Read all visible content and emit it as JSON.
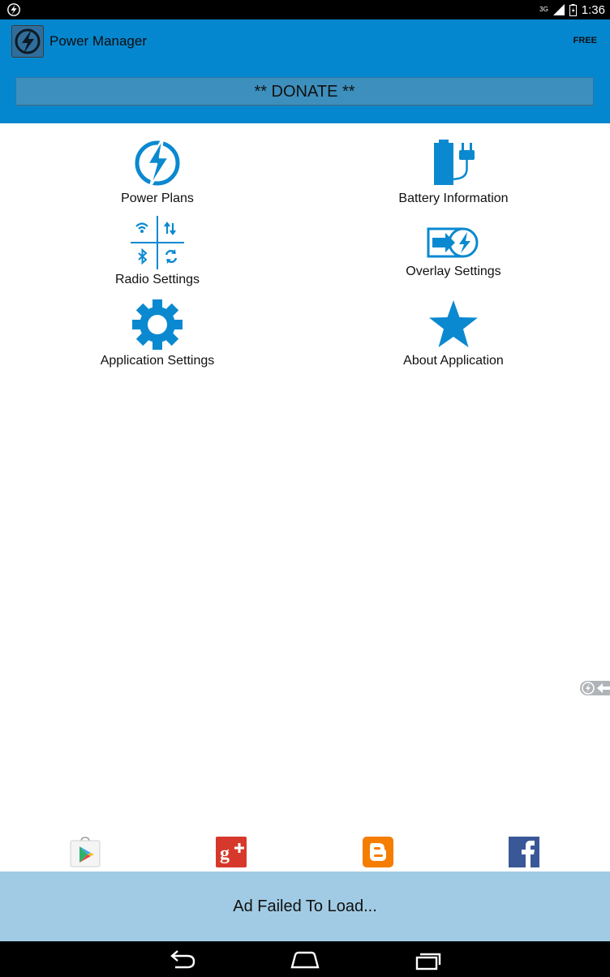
{
  "status_bar": {
    "network": "3G",
    "time": "1:36"
  },
  "app_bar": {
    "title": "Power Manager",
    "badge": "FREE",
    "donate_label": "** DONATE **"
  },
  "menu": {
    "items": [
      {
        "label": "Power Plans",
        "icon": "power-bolt-icon"
      },
      {
        "label": "Battery Information",
        "icon": "battery-plug-icon"
      },
      {
        "label": "Radio Settings",
        "icon": "radio-grid-icon"
      },
      {
        "label": "Overlay Settings",
        "icon": "overlay-arrow-icon"
      },
      {
        "label": "Application Settings",
        "icon": "gear-icon"
      },
      {
        "label": "About Application",
        "icon": "star-icon"
      }
    ]
  },
  "social": [
    {
      "name": "google-play-icon"
    },
    {
      "name": "google-plus-icon"
    },
    {
      "name": "blogger-icon"
    },
    {
      "name": "facebook-icon"
    }
  ],
  "ad_bar": {
    "text": "Ad Failed To Load..."
  },
  "colors": {
    "accent": "#0587cf",
    "icon_blue": "#0a89d0",
    "donate": "#3d8fbd",
    "ad_bar": "#a1cbe4"
  }
}
